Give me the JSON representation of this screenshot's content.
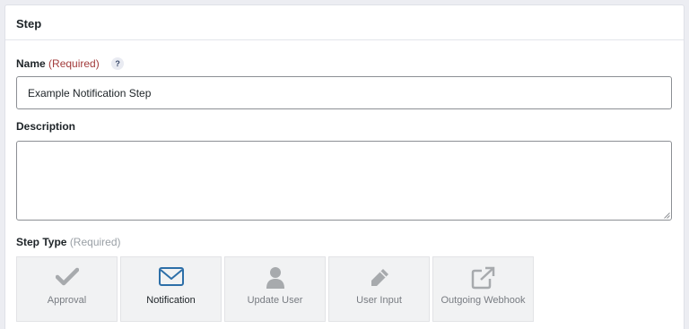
{
  "panel": {
    "title": "Step"
  },
  "name_field": {
    "label": "Name",
    "required_text": "(Required)",
    "help_glyph": "?",
    "value": "Example Notification Step"
  },
  "description_field": {
    "label": "Description",
    "value": ""
  },
  "step_type": {
    "label": "Step Type",
    "required_text": "(Required)",
    "selected": "Notification",
    "options": [
      {
        "label": "Approval",
        "icon": "checkmark-icon"
      },
      {
        "label": "Notification",
        "icon": "envelope-icon"
      },
      {
        "label": "Update User",
        "icon": "user-icon"
      },
      {
        "label": "User Input",
        "icon": "pencil-icon"
      },
      {
        "label": "Outgoing Webhook",
        "icon": "external-link-icon"
      }
    ]
  },
  "colors": {
    "required_red": "#a23b3b",
    "selected_icon_blue": "#2d6fa8",
    "muted_icon_gray": "#a7aaad"
  }
}
